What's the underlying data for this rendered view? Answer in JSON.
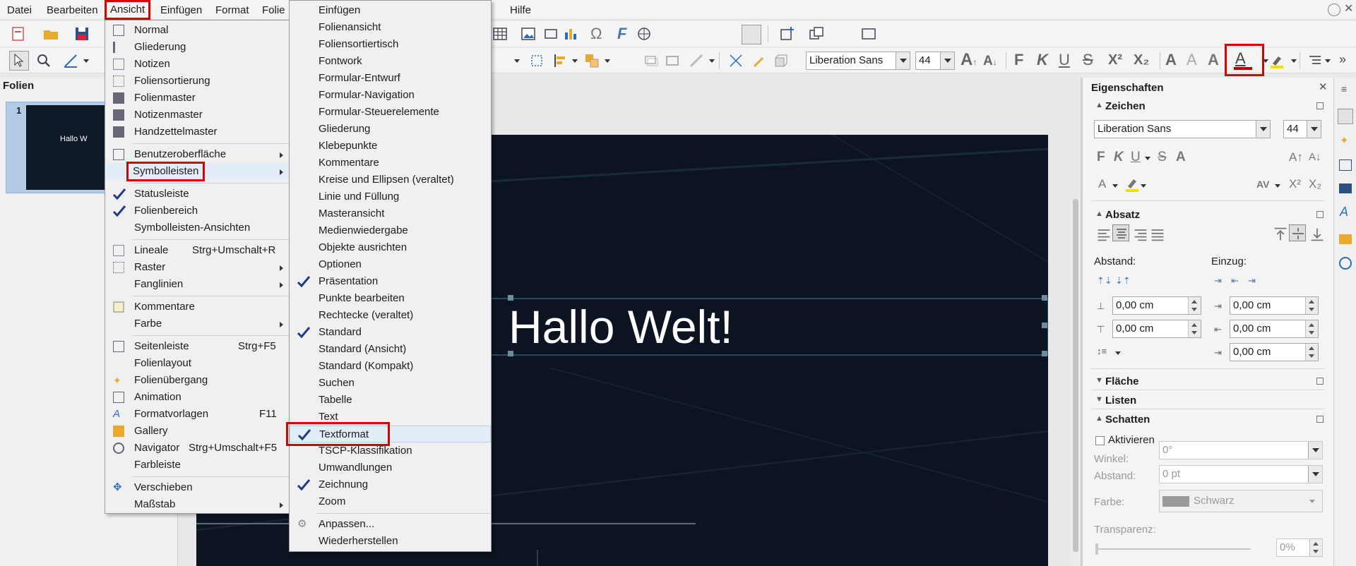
{
  "menubar": {
    "items": [
      "Datei",
      "Bearbeiten",
      "Ansicht",
      "Einfügen",
      "Format",
      "Folie",
      "Hilfe"
    ]
  },
  "toolbar": {
    "font_name": "Liberation Sans",
    "font_size": "44"
  },
  "slides_panel": {
    "title": "Folien",
    "slide_number": "1",
    "thumb_text": "Hallo W"
  },
  "slide": {
    "title_text": "Hallo Welt!"
  },
  "sidebar": {
    "title": "Eigenschaften",
    "zeichen": {
      "header": "Zeichen",
      "font_name": "Liberation Sans",
      "font_size": "44"
    },
    "absatz": {
      "header": "Absatz",
      "abstand_label": "Abstand:",
      "einzug_label": "Einzug:",
      "abstand_above": "0,00 cm",
      "abstand_below": "0,00 cm",
      "einzug_before": "0,00 cm",
      "einzug_after": "0,00 cm",
      "einzug_first": "0,00 cm"
    },
    "flaeche": {
      "header": "Fläche"
    },
    "listen": {
      "header": "Listen"
    },
    "schatten": {
      "header": "Schatten",
      "aktivieren": "Aktivieren",
      "winkel_label": "Winkel:",
      "winkel_value": "0°",
      "abstand_label": "Abstand:",
      "abstand_value": "0 pt",
      "farbe_label": "Farbe:",
      "farbe_value": "Schwarz",
      "transparenz_label": "Transparenz:",
      "transparenz_value": "0%"
    }
  },
  "ansicht_menu": {
    "items": [
      {
        "label": "Normal"
      },
      {
        "label": "Gliederung"
      },
      {
        "label": "Notizen"
      },
      {
        "label": "Foliensortierung"
      },
      {
        "label": "Folienmaster"
      },
      {
        "label": "Notizenmaster"
      },
      {
        "label": "Handzettelmaster"
      },
      {
        "label": "Benutzeroberfläche"
      },
      {
        "label": "Symbolleisten"
      },
      {
        "label": "Statusleiste"
      },
      {
        "label": "Folienbereich"
      },
      {
        "label": "Symbolleisten-Ansichten"
      },
      {
        "label": "Lineale",
        "shortcut": "Strg+Umschalt+R"
      },
      {
        "label": "Raster"
      },
      {
        "label": "Fanglinien"
      },
      {
        "label": "Kommentare"
      },
      {
        "label": "Farbe"
      },
      {
        "label": "Seitenleiste",
        "shortcut": "Strg+F5"
      },
      {
        "label": "Folienlayout"
      },
      {
        "label": "Folienübergang"
      },
      {
        "label": "Animation"
      },
      {
        "label": "Formatvorlagen",
        "shortcut": "F11"
      },
      {
        "label": "Gallery"
      },
      {
        "label": "Navigator",
        "shortcut": "Strg+Umschalt+F5"
      },
      {
        "label": "Farbleiste"
      },
      {
        "label": "Verschieben"
      },
      {
        "label": "Maßstab"
      }
    ]
  },
  "symbolleisten_menu": {
    "items": [
      "Einfügen",
      "Folienansicht",
      "Foliensortiertisch",
      "Fontwork",
      "Formular-Entwurf",
      "Formular-Navigation",
      "Formular-Steuerelemente",
      "Gliederung",
      "Klebepunkte",
      "Kommentare",
      "Kreise und Ellipsen (veraltet)",
      "Linie und Füllung",
      "Masteransicht",
      "Medienwiedergabe",
      "Objekte ausrichten",
      "Optionen",
      "Präsentation",
      "Punkte bearbeiten",
      "Rechtecke (veraltet)",
      "Standard",
      "Standard (Ansicht)",
      "Standard (Kompakt)",
      "Suchen",
      "Tabelle",
      "Text",
      "Textformat",
      "TSCP-Klassifikation",
      "Umwandlungen",
      "Zeichnung",
      "Zoom",
      "Anpassen...",
      "Wiederherstellen"
    ]
  },
  "colors": {
    "highlight_box": "#d90000",
    "checkmark": "#1f3b8a",
    "slide_bg": "#0b1420",
    "font_color_accent": "#c00000"
  }
}
